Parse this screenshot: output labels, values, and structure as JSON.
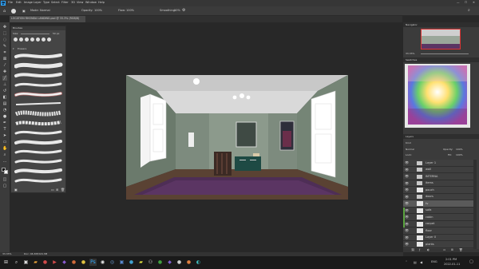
{
  "app": {
    "logo": "Ps",
    "menu": [
      "File",
      "Edit",
      "Image",
      "Layer",
      "Type",
      "Select",
      "Filter",
      "3D",
      "View",
      "Window",
      "Help"
    ]
  },
  "options_bar": {
    "mode_label": "Mode:",
    "mode_value": "Normal",
    "opacity_label": "Opacity:",
    "opacity_value": "100%",
    "flow_label": "Flow:",
    "flow_value": "100%",
    "smoothing_label": "Smoothing:",
    "smoothing_value": "10%"
  },
  "document_tab": {
    "title": "LOCATION RHONDA LANDING.psd @ 33.3% (RGB/8)"
  },
  "brushes_panel": {
    "title": "Brushes",
    "size_label": "Size:",
    "size_value": "50 px",
    "folder_label": "Erasers"
  },
  "navigator": {
    "title": "Navigator",
    "zoom": "33.33%"
  },
  "swatches": {
    "title": "Swatches"
  },
  "layers_panel": {
    "title": "Layers",
    "kind_label": "Kind",
    "blend_mode": "Normal",
    "opacity_label": "Opacity:",
    "opacity_value": "100%",
    "lock_label": "Lock:",
    "fill_label": "Fill:",
    "fill_value": "100%",
    "layers": [
      {
        "name": "Layer 1",
        "type": "folder"
      },
      {
        "name": "wall",
        "type": "folder"
      },
      {
        "name": "INTERNA",
        "type": "folder"
      },
      {
        "name": "items",
        "type": "folder"
      },
      {
        "name": "pouch",
        "type": "layer"
      },
      {
        "name": "doors",
        "type": "folder"
      },
      {
        "name": "tv",
        "type": "layer",
        "selected": true
      },
      {
        "name": "sofa",
        "type": "layer"
      },
      {
        "name": "cabin",
        "type": "layer"
      },
      {
        "name": "carpet",
        "type": "layer"
      },
      {
        "name": "floor",
        "type": "layer"
      },
      {
        "name": "Layer 0",
        "type": "layer"
      },
      {
        "name": "plants",
        "type": "layer"
      }
    ]
  },
  "status_bar": {
    "zoom": "33.33%",
    "doc_size": "Doc: 46.3M/324.3M"
  },
  "taskbar": {
    "time": "2:01 PM",
    "date": "2022-01-11",
    "lang": "ENG",
    "search_placeholder": "Type here to search"
  },
  "colors": {
    "accent_green": "#5aa33f",
    "panel_bg": "#3b3b3b",
    "workspace_bg": "#282828"
  }
}
